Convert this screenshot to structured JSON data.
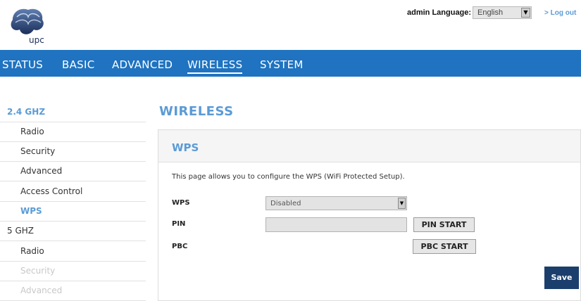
{
  "header": {
    "logo_text": "upc",
    "admin_language_label": "admin Language:",
    "language_value": "English",
    "logout_label": "> Log out"
  },
  "nav": {
    "items": [
      "STATUS",
      "BASIC",
      "ADVANCED",
      "WIRELESS",
      "SYSTEM"
    ],
    "active": "WIRELESS"
  },
  "sidebar": {
    "items": [
      {
        "label": "2.4 GHZ",
        "type": "group",
        "state": "highlight"
      },
      {
        "label": "Radio",
        "type": "sub",
        "state": "normal"
      },
      {
        "label": "Security",
        "type": "sub",
        "state": "normal"
      },
      {
        "label": "Advanced",
        "type": "sub",
        "state": "normal"
      },
      {
        "label": "Access Control",
        "type": "sub",
        "state": "normal"
      },
      {
        "label": "WPS",
        "type": "sub",
        "state": "active"
      },
      {
        "label": "5 GHZ",
        "type": "group",
        "state": "normal"
      },
      {
        "label": "Radio",
        "type": "sub",
        "state": "normal"
      },
      {
        "label": "Security",
        "type": "sub",
        "state": "disabled"
      },
      {
        "label": "Advanced",
        "type": "sub",
        "state": "disabled"
      }
    ]
  },
  "main": {
    "page_title": "WIRELESS",
    "panel_title": "WPS",
    "description": "This page allows you to configure the WPS (WiFi Protected Setup).",
    "fields": {
      "wps_label": "WPS",
      "wps_value": "Disabled",
      "pin_label": "PIN",
      "pin_value": "",
      "pbc_label": "PBC"
    },
    "buttons": {
      "pin_start": "PIN START",
      "pbc_start": "PBC START",
      "save": "Save"
    }
  },
  "colors": {
    "nav_bg": "#1f73c0",
    "accent_blue": "#5b9bd5",
    "save_bg": "#1b3f6d",
    "disabled_text": "#c8c8c8"
  }
}
